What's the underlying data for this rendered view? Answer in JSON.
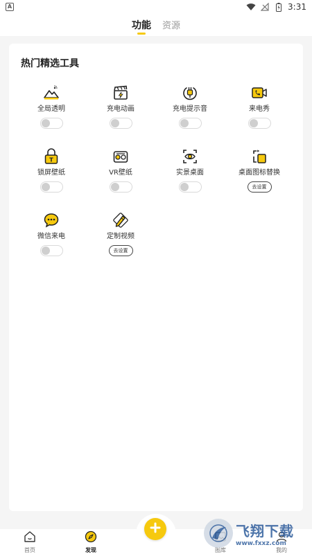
{
  "status_bar": {
    "time": "3:31"
  },
  "tabs": [
    {
      "label": "功能",
      "active": true
    },
    {
      "label": "资源",
      "active": false
    }
  ],
  "section": {
    "title": "热门精选工具",
    "tools": [
      {
        "label": "全局透明",
        "icon": "mountain-sun-icon",
        "control": "toggle",
        "on": false
      },
      {
        "label": "充电动画",
        "icon": "clapperboard-bolt-icon",
        "control": "toggle",
        "on": false
      },
      {
        "label": "充电提示音",
        "icon": "plug-icon",
        "control": "toggle",
        "on": false
      },
      {
        "label": "来电秀",
        "icon": "video-call-icon",
        "control": "toggle",
        "on": false
      },
      {
        "label": "锁屏壁纸",
        "icon": "lock-t-icon",
        "control": "toggle",
        "on": false
      },
      {
        "label": "VR壁纸",
        "icon": "vr-glasses-icon",
        "control": "toggle",
        "on": false
      },
      {
        "label": "实景桌面",
        "icon": "eye-scan-icon",
        "control": "toggle",
        "on": false
      },
      {
        "label": "桌面图标替换",
        "icon": "icon-replace-icon",
        "control": "button",
        "button_label": "去设置"
      },
      {
        "label": "微信来电",
        "icon": "wechat-call-icon",
        "control": "toggle",
        "on": false
      },
      {
        "label": "定制视频",
        "icon": "pencil-square-icon",
        "control": "button",
        "button_label": "去设置"
      }
    ]
  },
  "bottom_nav": {
    "items": [
      {
        "label": "首页",
        "icon": "home-icon",
        "active": false
      },
      {
        "label": "发现",
        "icon": "compass-icon",
        "active": true
      },
      {
        "label": "图库",
        "icon": "gallery-icon",
        "active": false
      },
      {
        "label": "我的",
        "icon": "profile-icon",
        "active": false
      }
    ],
    "center_icon": "plus-icon"
  },
  "watermark": {
    "cn": "飞翔下载",
    "en": "www.fxxz.com"
  },
  "colors": {
    "accent": "#f6c90e",
    "text": "#222222",
    "background": "#f5f5f5"
  }
}
